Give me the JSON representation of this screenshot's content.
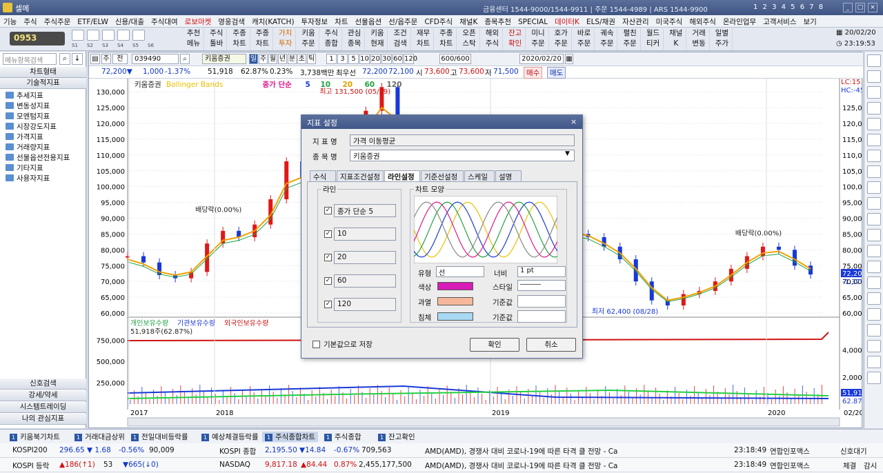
{
  "window": {
    "title": "셀메",
    "contact": "금융센터 1544-9000/1544-9911 | 주문 1544-4989 | ARS 1544-9900",
    "screen_nums": "1 2 3 4 5 6 7 8"
  },
  "menu": [
    {
      "label": "기능"
    },
    {
      "label": "주식"
    },
    {
      "label": "주식주문"
    },
    {
      "label": "ETF/ELW"
    },
    {
      "label": "신용/대출"
    },
    {
      "label": "주식대여"
    },
    {
      "label": "로보마켓",
      "red": true
    },
    {
      "label": "영웅검색"
    },
    {
      "label": "캐치(KATCH)"
    },
    {
      "label": "투자정보"
    },
    {
      "label": "차트"
    },
    {
      "label": "선물옵션"
    },
    {
      "label": "선/옵주문"
    },
    {
      "label": "CFD주식"
    },
    {
      "label": "채널K"
    },
    {
      "label": "종목추천"
    },
    {
      "label": "SPECIAL"
    },
    {
      "label": "데이터K",
      "red": true
    },
    {
      "label": "ELS/채권"
    },
    {
      "label": "자산관리"
    },
    {
      "label": "미국주식"
    },
    {
      "label": "해외주식"
    },
    {
      "label": "온라인업무"
    },
    {
      "label": "고객서비스"
    },
    {
      "label": "보기"
    }
  ],
  "toolbar": {
    "code": "0953",
    "tabs": [
      "S1",
      "S2",
      "S3",
      "S4",
      "S5",
      "S6"
    ],
    "buttons": [
      {
        "l1": "추천",
        "l2": "메뉴"
      },
      {
        "l1": "주식",
        "l2": "툴바"
      },
      {
        "l1": "주종",
        "l2": "차트"
      },
      {
        "l1": "주종",
        "l2": "차트"
      },
      {
        "l1": "가치",
        "l2": "투자",
        "c": "orange"
      },
      {
        "l1": "키움",
        "l2": "주문"
      },
      {
        "l1": "주식",
        "l2": "종합"
      },
      {
        "l1": "관심",
        "l2": "종목"
      },
      {
        "l1": "키움",
        "l2": "현재"
      },
      {
        "l1": "조건",
        "l2": "검색"
      },
      {
        "l1": "재무",
        "l2": "차트"
      },
      {
        "l1": "주종",
        "l2": "차트"
      },
      {
        "l1": "오픈",
        "l2": "스탁"
      },
      {
        "l1": "해외",
        "l2": "주식"
      },
      {
        "l1": "잔고",
        "l2": "확인",
        "c": "red"
      },
      {
        "l1": "미니",
        "l2": "주문"
      },
      {
        "l1": "호가",
        "l2": "주문"
      },
      {
        "l1": "바로",
        "l2": "주문"
      },
      {
        "l1": "궤속",
        "l2": "주문"
      },
      {
        "l1": "펼친",
        "l2": "주문"
      },
      {
        "l1": "월드",
        "l2": "티커"
      },
      {
        "l1": "채널",
        "l2": "K"
      },
      {
        "l1": "거래",
        "l2": "변동"
      },
      {
        "l1": "일별",
        "l2": "주가"
      }
    ],
    "date": "20/02/20",
    "time": "23:19:53"
  },
  "left_panel": {
    "search_placeholder": "메뉴항목검색",
    "sec1": "차트형태",
    "sec2": "기술적지표",
    "items": [
      "추세지표",
      "변동성지표",
      "모멘텀지표",
      "시장강도지표",
      "가격지표",
      "거래량지표",
      "선물옵션전용지표",
      "기타지표",
      "사용자지표"
    ],
    "bottom": [
      "신호검색",
      "강세/약세",
      "시스템트레이딩",
      "나의 관심지표"
    ]
  },
  "chart_ctrl": {
    "code": "039490",
    "name": "키움증권",
    "periods": [
      "일",
      "주",
      "월",
      "년",
      "분",
      "초",
      "틱"
    ],
    "nums": [
      "1",
      "3",
      "5",
      "10",
      "20",
      "30",
      "60",
      "120"
    ],
    "count": "600/600",
    "date": "2020/02/20",
    "price": "72,200▼",
    "change": "1,000",
    "pct": "-1.37%",
    "volume": "51,918",
    "vol_pct": "62.87%",
    "turnover": "0.23%",
    "amount": "3,738백만",
    "best_ask_label": "최우선",
    "best_ask": "72,200",
    "best_bid": "72,100",
    "open_label": "시",
    "open": "73,600",
    "high_label": "고",
    "high": "73,600",
    "low_label": "저",
    "low": "71,500",
    "buy": "매수",
    "sell": "매도"
  },
  "chart_data": {
    "type": "line",
    "legend": [
      "키움증권",
      "Bollinger Bands",
      "종가 단순",
      "5",
      "10",
      "20",
      "60",
      "120"
    ],
    "x_labels": [
      "2017",
      "2018",
      "2019",
      "2020"
    ],
    "y_ticks": [
      60000,
      65000,
      70000,
      75000,
      80000,
      85000,
      90000,
      95000,
      100000,
      105000,
      110000,
      115000,
      120000,
      125000,
      130000
    ],
    "y_labels": [
      "60,000",
      "65,000",
      "70,000",
      "75,000",
      "80,000",
      "85,000",
      "90,000",
      "95,000",
      "100,000",
      "105,000",
      "110,000",
      "115,000",
      "120,000",
      "125,000",
      "130,000"
    ],
    "y_labels_right": [
      "60,000",
      "65,000",
      "70,000",
      "75,000",
      "80,000",
      "85,000",
      "90,000",
      "95,000",
      "100,000",
      "105,000",
      "110,000",
      "115,000",
      "120,000",
      "125,000"
    ],
    "price_series": [
      78000,
      76000,
      72000,
      71000,
      73000,
      82000,
      86000,
      84000,
      88000,
      96000,
      108000,
      103000,
      112000,
      106000,
      114000,
      124000,
      131500,
      121000,
      111000,
      106000,
      101000,
      99000,
      96000,
      94000,
      92000,
      90000,
      88000,
      86000,
      85000,
      84000,
      81000,
      77000,
      70000,
      64000,
      62400,
      66000,
      67000,
      70000,
      74000,
      78000,
      81000,
      80000,
      75000,
      72200
    ],
    "ma_series": [
      77000,
      75500,
      73000,
      72000,
      73000,
      78000,
      83000,
      84000,
      86000,
      91000,
      101000,
      103000,
      108000,
      106000,
      111000,
      118000,
      125000,
      121000,
      113000,
      108000,
      104000,
      101000,
      98000,
      95000,
      93000,
      91000,
      89000,
      87000,
      85500,
      84500,
      82000,
      79000,
      74000,
      68000,
      64000,
      65000,
      66500,
      68500,
      72000,
      76000,
      79000,
      79500,
      77000,
      74000
    ],
    "annotations": {
      "high": "최고 131,500 (05/29)",
      "low": "최저 62,400 (08/28)",
      "div1": "배당락(0.00%)",
      "div2": "배당락(0.00%)"
    },
    "right_info": {
      "lc": "LC:15.71",
      "hc": "HC:-45.10",
      "price": "72,200",
      "pct": "-1.37%"
    },
    "sub_legend": [
      "개인보유수량",
      "기관보유수량",
      "외국인보유수량"
    ],
    "sub_first": "51,918주(62.87%)",
    "sub_y_left": [
      "250,000",
      "500,000",
      "750,000"
    ],
    "sub_y_right": [
      "2,000,000",
      "4,000,000"
    ],
    "sub_last": "51,918",
    "sub_last_pct": "62.87%",
    "bottom_date": "02/20"
  },
  "dialog": {
    "title": "지표 설정",
    "name_label": "지 표 명",
    "name_value": "가격 이동평균",
    "item_label": "종 목 명",
    "item_value": "키움증권",
    "tabs": [
      "수식",
      "지표조건설정",
      "라인설정",
      "기준선설정",
      "스케일",
      "설명"
    ],
    "active_tab": "라인설정",
    "line_group": "라인",
    "lines": [
      "종가 단순 5",
      "10",
      "20",
      "60",
      "120"
    ],
    "shape_group": "차트 모양",
    "type_label": "유형",
    "type_value": "선",
    "width_label": "너비",
    "width_value": "1 pt",
    "color_label": "색상",
    "style_label": "스타일",
    "over_label": "과열",
    "base_label1": "기준값",
    "under_label": "침체",
    "base_label2": "기준값",
    "save_default": "기본값으로 저장",
    "ok": "확인",
    "cancel": "취소",
    "colors": {
      "line": "#d81cb8",
      "over": "#f6b89a",
      "under": "#a8d8f2"
    }
  },
  "taskbar": [
    "키움북기차트",
    "거래대금상위",
    "전일대비등락률",
    "예상체결등락률",
    "주식종합차트",
    "주식종합",
    "잔고확인"
  ],
  "ticker": {
    "row1": {
      "name1": "KOSPI200",
      "v1": "296.65",
      "c1": "▼ 1.68",
      "p1": "-0.56%",
      "vol1": "90,009",
      "name2": "KOSPI 종합",
      "v2": "2,195.50",
      "c2": "▼14.84",
      "p2": "-0.67%",
      "vol2": "709,563",
      "news": "AMD(AMD), 경쟁사 대비 코로나-19에 따른 타격 클 전망 - Ca",
      "time": "23:18:49",
      "src": "연합인포맥스",
      "extra": "신호대기"
    },
    "row2": {
      "name1": "KOSPI 등락",
      "v1": "▲186(↑1)",
      "c1": "53",
      "p1": "▼665(↓0)",
      "name2": "NASDAQ",
      "v2": "9,817.18",
      "c2": "▲84.44",
      "p2": "0.87%",
      "vol2": "2,455,177,500",
      "news": "AMD(AMD), 경쟁사 대비 코로나-19에 따른 타격 클 전망 - Ca",
      "time": "23:18:49",
      "src": "연합인포맥스",
      "extra1": "체결",
      "extra2": "감시"
    }
  }
}
